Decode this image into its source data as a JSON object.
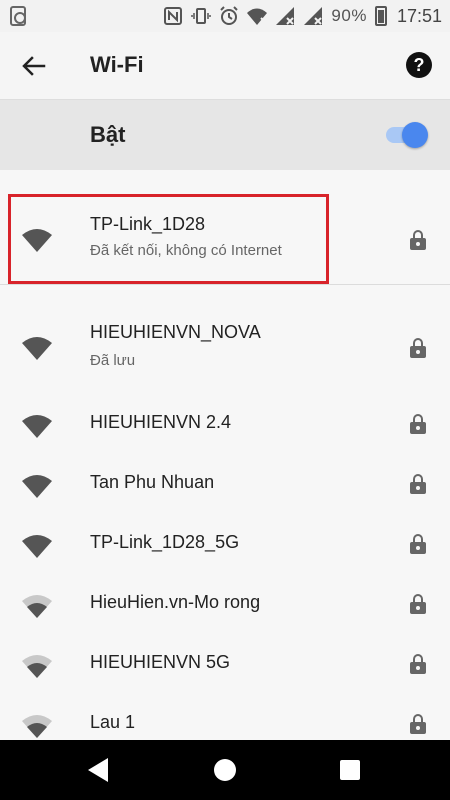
{
  "status_bar": {
    "battery": "90%",
    "time": "17:51"
  },
  "app_bar": {
    "title": "Wi-Fi"
  },
  "wifi_toggle": {
    "label": "Bật",
    "state": "on"
  },
  "networks": [
    {
      "name": "TP-Link_1D28",
      "subtitle": "Đã kết nối, không có Internet",
      "secured": true,
      "signal": "full",
      "highlighted": true
    },
    {
      "name": "HIEUHIENVN_NOVA",
      "subtitle": "Đã lưu",
      "secured": true,
      "signal": "full"
    },
    {
      "name": "HIEUHIENVN 2.4",
      "secured": true,
      "signal": "full"
    },
    {
      "name": "Tan Phu Nhuan",
      "secured": true,
      "signal": "full"
    },
    {
      "name": "TP-Link_1D28_5G",
      "secured": true,
      "signal": "full"
    },
    {
      "name": "HieuHien.vn-Mo rong",
      "secured": true,
      "signal": "weak"
    },
    {
      "name": "HIEUHIENVN 5G",
      "secured": true,
      "signal": "weak"
    },
    {
      "name": "Lau 1",
      "secured": true,
      "signal": "weak"
    }
  ],
  "colors": {
    "accent": "#4a87ee",
    "highlight_border": "#d8232a"
  }
}
